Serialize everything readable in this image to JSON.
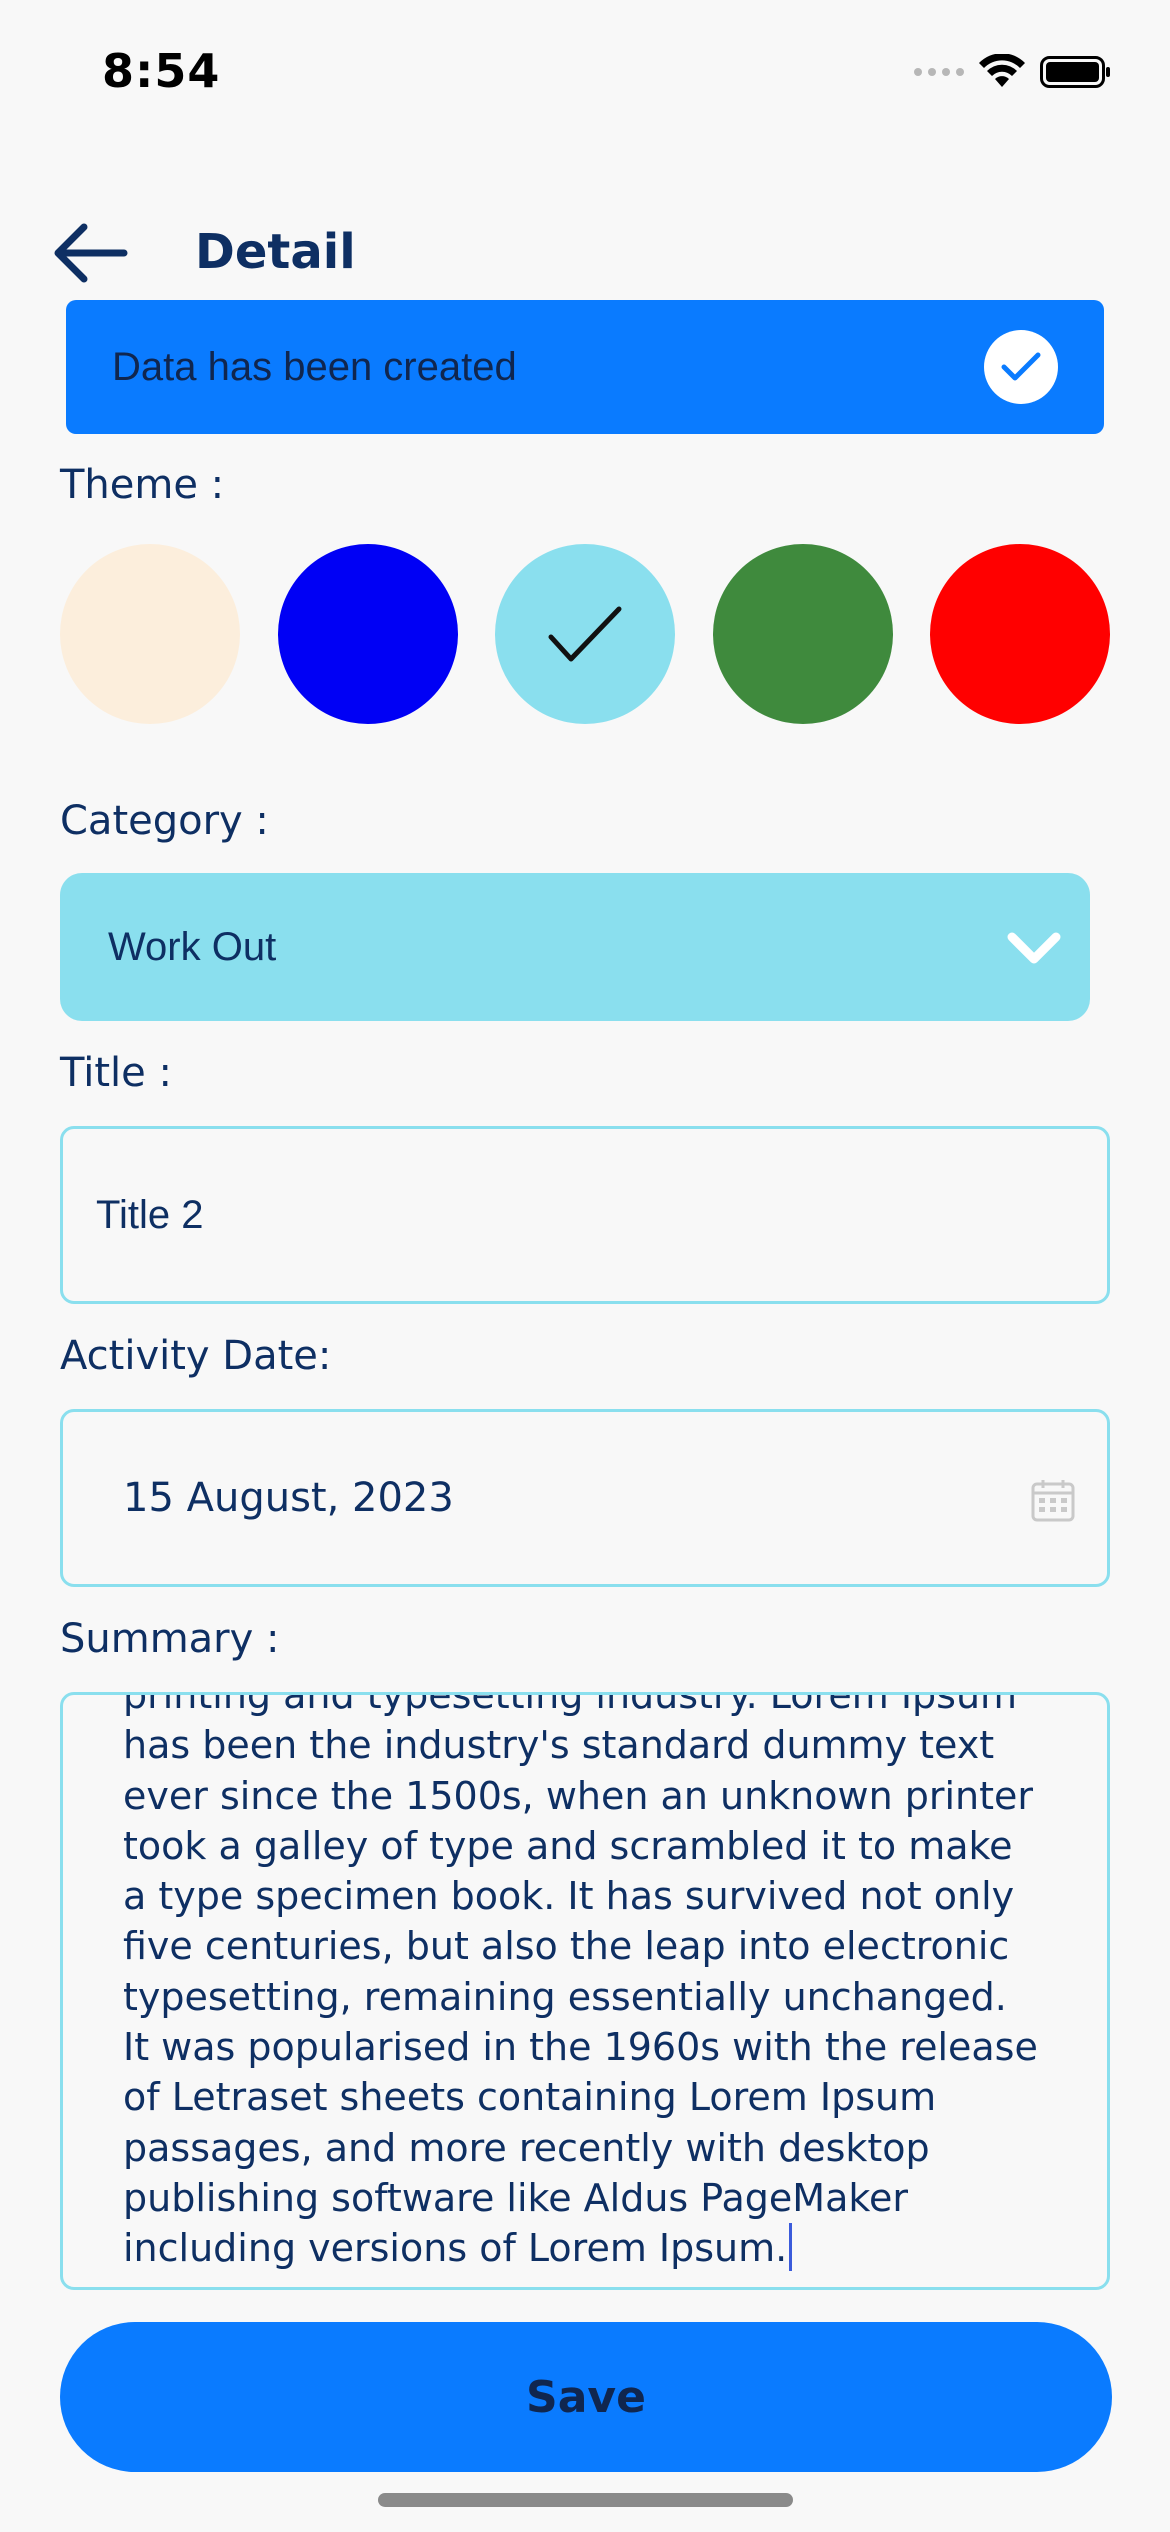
{
  "status_bar": {
    "time": "8:54",
    "icons": [
      "cellular-signal-icon",
      "wifi-icon",
      "battery-icon"
    ]
  },
  "header": {
    "back_icon": "arrow-left-icon",
    "title": "Detail"
  },
  "toast": {
    "message": "Data has been created",
    "icon": "check-circle-icon",
    "color": "#0A7BFF"
  },
  "theme": {
    "label": "Theme :",
    "swatches": [
      {
        "color": "#FCEEDC",
        "selected": false
      },
      {
        "color": "#0000F5",
        "selected": false
      },
      {
        "color": "#8ADFEE",
        "selected": true
      },
      {
        "color": "#3F8A3D",
        "selected": false
      },
      {
        "color": "#FF0000",
        "selected": false
      }
    ]
  },
  "category": {
    "label": "Category :",
    "selected": "Work Out",
    "icon": "chevron-down-icon"
  },
  "title_field": {
    "label": "Title :",
    "value": "Title 2"
  },
  "date_field": {
    "label": "Activity Date:",
    "value": "15 August, 2023",
    "icon": "calendar-icon"
  },
  "summary_field": {
    "label": "Summary :",
    "value": "printing and typesetting industry. Lorem Ipsum\nhas been the industry's standard dummy text\never since the 1500s, when an unknown printer\ntook a galley of type and scrambled it to make\na type specimen book. It has survived not only\nfive centuries, but also the leap into electronic\ntypesetting, remaining essentially unchanged.\nIt was popularised in the 1960s with the release\nof Letraset sheets containing Lorem Ipsum\npassages, and more recently with desktop\npublishing software like Aldus PageMaker\nincluding versions of Lorem Ipsum."
  },
  "save_button": {
    "label": "Save"
  },
  "colors": {
    "accent": "#0A7BFF",
    "text_primary": "#0E2F63",
    "field_border": "#8ADFEE",
    "background": "#F8F8F8"
  }
}
